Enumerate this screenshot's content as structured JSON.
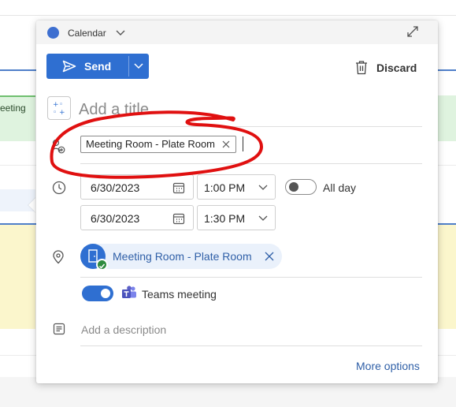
{
  "header": {
    "calendar_label": "Calendar",
    "calendar_color": "#3e6fd0"
  },
  "toolbar": {
    "send_label": "Send",
    "discard_label": "Discard"
  },
  "event": {
    "title_placeholder": "Add a title",
    "attendee": "Meeting Room - Plate Room",
    "start_date": "6/30/2023",
    "start_time": "1:00 PM",
    "end_date": "6/30/2023",
    "end_time": "1:30 PM",
    "all_day_label": "All day",
    "all_day_on": false,
    "location": "Meeting Room - Plate Room",
    "teams_meeting_label": "Teams meeting",
    "teams_meeting_on": true,
    "description_placeholder": "Add a description",
    "more_options_label": "More options"
  },
  "background": {
    "event_snippet": "eeting"
  },
  "annotation": {
    "color": "#e01010"
  },
  "colors": {
    "accent": "#2f6fd1",
    "link": "#2f5fa7",
    "success": "#2e8b3e",
    "teams": "#5b5fc7"
  }
}
